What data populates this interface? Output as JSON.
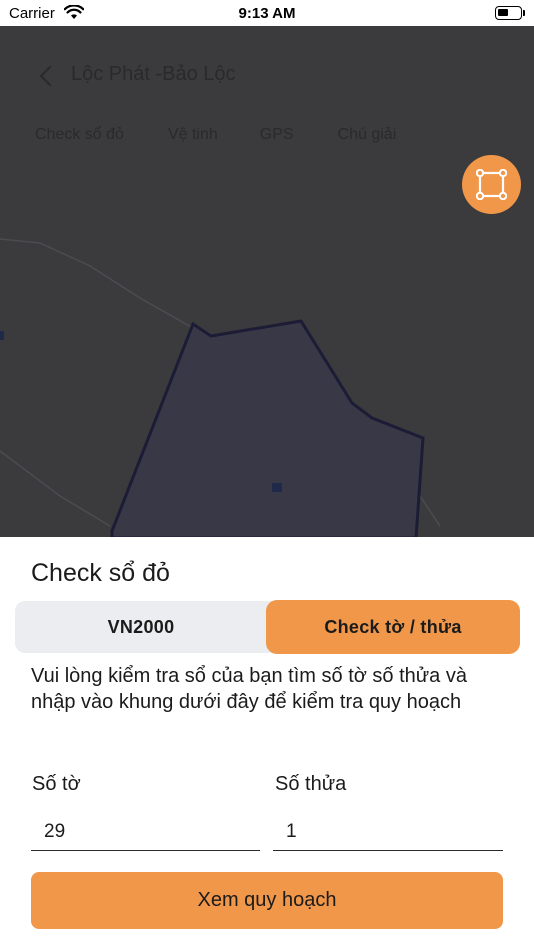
{
  "status_bar": {
    "carrier": "Carrier",
    "time": "9:13 AM",
    "wifi_icon": "wifi-icon",
    "battery_icon": "battery-icon"
  },
  "map_screen": {
    "title": "Lộc Phát -Bảo Lộc",
    "back_icon": "chevron-left-icon",
    "tabs": [
      "Check sổ đỏ",
      "Vệ tinh",
      "GPS",
      "Chú giải"
    ],
    "fab_icon": "polygon-draw-icon",
    "accent_color": "#f0974a"
  },
  "sheet": {
    "title": "Check sổ đỏ",
    "segments": [
      {
        "label": "VN2000",
        "selected": false
      },
      {
        "label": "Check tờ / thửa",
        "selected": true
      }
    ],
    "instructions": "Vui lòng kiểm tra sổ của bạn tìm số tờ số thửa và nhập vào khung dưới đây để kiểm tra quy hoạch",
    "fields": [
      {
        "label": "Số tờ",
        "value": "29"
      },
      {
        "label": "Số thửa",
        "value": "1"
      }
    ],
    "submit_label": "Xem quy hoạch"
  }
}
